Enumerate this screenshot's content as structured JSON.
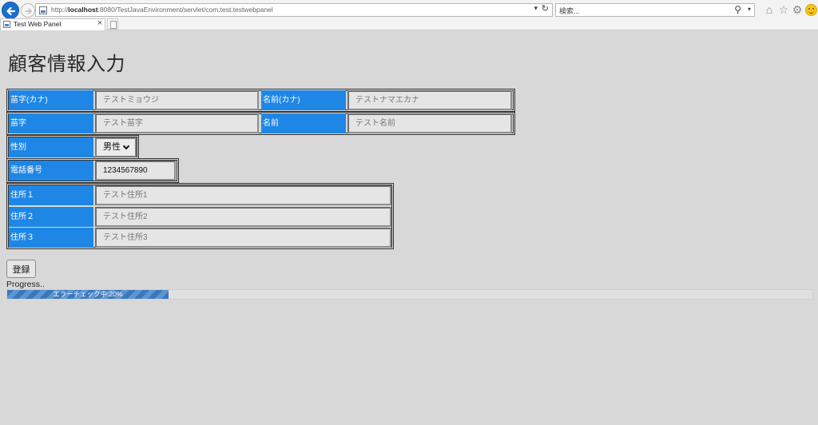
{
  "browser": {
    "url_prefix": "http://",
    "url_host": "localhost",
    "url_rest": ":8080/TestJavaEnvironment/servlet/com.test.testwebpanel",
    "search_placeholder": "検索...",
    "tab_title": "Test Web Panel"
  },
  "page": {
    "title": "顧客情報入力"
  },
  "form": {
    "last_name_kana": {
      "label": "苗字(カナ)",
      "placeholder": "テストミョウジ"
    },
    "first_name_kana": {
      "label": "名前(カナ)",
      "placeholder": "テストナマエカナ"
    },
    "last_name": {
      "label": "苗字",
      "placeholder": "テスト苗字"
    },
    "first_name": {
      "label": "名前",
      "placeholder": "テスト名前"
    },
    "gender": {
      "label": "性別",
      "selected": "男性"
    },
    "phone": {
      "label": "電話番号",
      "value": "1234567890"
    },
    "address1": {
      "label": "住所１",
      "placeholder": "テスト住所1"
    },
    "address2": {
      "label": "住所２",
      "placeholder": "テスト住所2"
    },
    "address3": {
      "label": "住所３",
      "placeholder": "テスト住所3"
    }
  },
  "actions": {
    "register_label": "登録"
  },
  "progress": {
    "label": "Progress..",
    "text": "エラーチェック中:20%",
    "percent": 20
  }
}
